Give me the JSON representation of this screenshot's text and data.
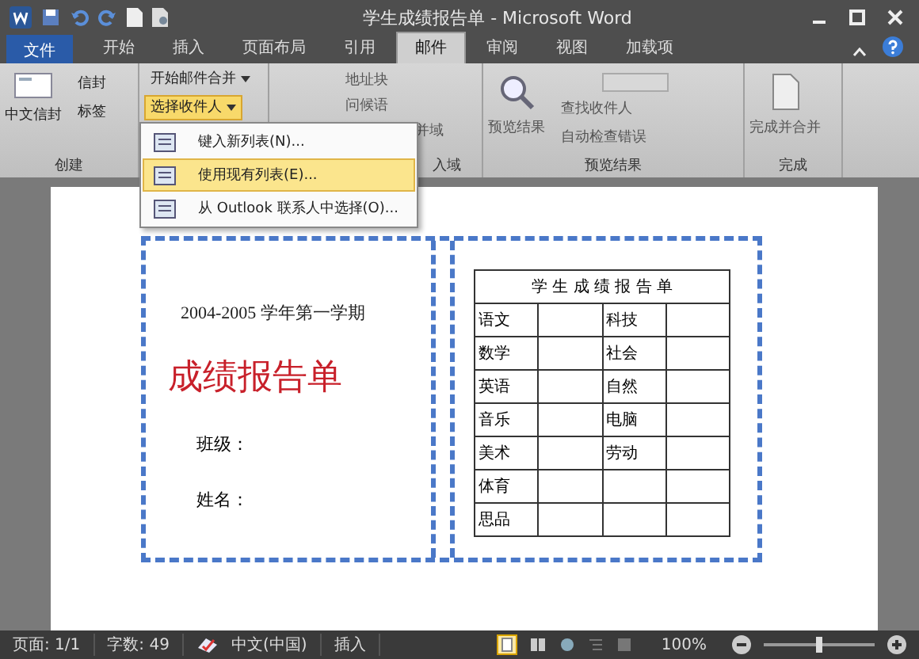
{
  "window": {
    "title": "学生成绩报告单 - Microsoft Word"
  },
  "tabs": [
    {
      "label": "文件",
      "kind": "file",
      "selected": false
    },
    {
      "label": "开始",
      "kind": "tab",
      "selected": false
    },
    {
      "label": "插入",
      "kind": "tab",
      "selected": false
    },
    {
      "label": "页面布局",
      "kind": "tab",
      "selected": false
    },
    {
      "label": "引用",
      "kind": "tab",
      "selected": false
    },
    {
      "label": "邮件",
      "kind": "tab",
      "selected": true
    },
    {
      "label": "审阅",
      "kind": "tab",
      "selected": false
    },
    {
      "label": "视图",
      "kind": "tab",
      "selected": false
    },
    {
      "label": "加载项",
      "kind": "tab",
      "selected": false
    }
  ],
  "ribbon": {
    "create": {
      "label": "创建",
      "big": "中文信封",
      "small": [
        "信封",
        "标签"
      ]
    },
    "merge": {
      "buttons": [
        {
          "label": "开始邮件合并",
          "selected": false
        },
        {
          "label": "选择收件人",
          "selected": true
        }
      ]
    },
    "fields": {
      "small": [
        "地址块",
        "问候语"
      ],
      "cut_button": "并域",
      "label": "入域"
    },
    "preview": {
      "big": "预览结果",
      "small": [
        "查找收件人",
        "自动检查错误"
      ],
      "label": "预览结果"
    },
    "finish": {
      "big": "完成并合并",
      "label": "完成"
    }
  },
  "menu": {
    "items": [
      {
        "label": "键入新列表(N)...",
        "selected": false
      },
      {
        "label": "使用现有列表(E)...",
        "selected": true
      },
      {
        "label": "从 Outlook 联系人中选择(O)...",
        "selected": false
      }
    ]
  },
  "document": {
    "term": "2004-2005 学年第一学期",
    "title": "成绩报告单",
    "fields": [
      "班级：",
      "姓名："
    ],
    "report": {
      "title": "学 生 成 绩 报 告 单",
      "rows": [
        {
          "left": "语文",
          "right": "科技"
        },
        {
          "left": "数学",
          "right": "社会"
        },
        {
          "left": "英语",
          "right": "自然"
        },
        {
          "left": "音乐",
          "right": "电脑"
        },
        {
          "left": "美术",
          "right": "劳动"
        },
        {
          "left": "体育"
        },
        {
          "left": "思品"
        }
      ]
    }
  },
  "status_bar": {
    "items": [
      "页面: 1/1",
      "字数: 49",
      "中文(中国)",
      "插入"
    ],
    "zoom": "100%",
    "zoom_level": {
      "level": 0.5
    }
  }
}
